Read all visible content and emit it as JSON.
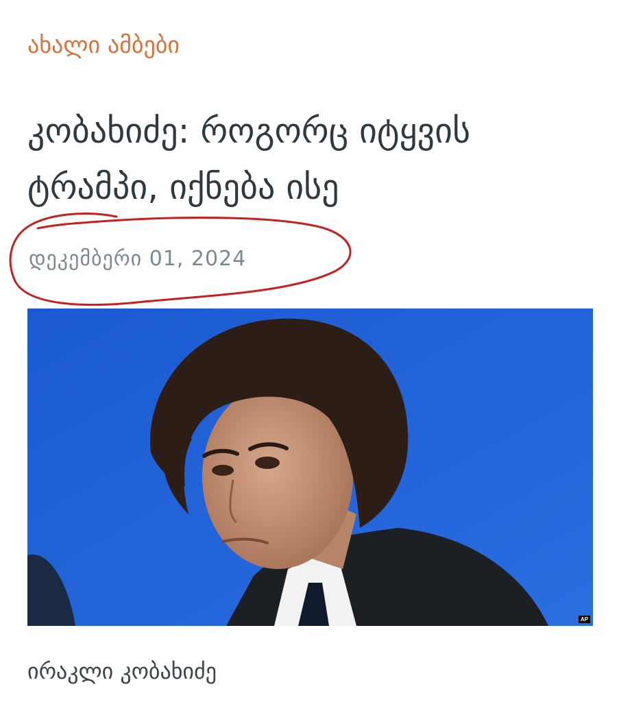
{
  "article": {
    "category": "ახალი ამბები",
    "headline": "კობახიძე: როგორც იტყვის ტრამპი, იქნება ისე",
    "date": "დეკემბერი 01, 2024",
    "photo_credit": "AP",
    "caption": "ირაკლი კობახიძე"
  },
  "colors": {
    "category": "#d9723b",
    "headline": "#2e3a3f",
    "date": "#7a8a90",
    "annotation": "#c81e1e",
    "photo_background": "#1f5fd1"
  },
  "icons": {
    "annotation": "hand-drawn-circle"
  }
}
